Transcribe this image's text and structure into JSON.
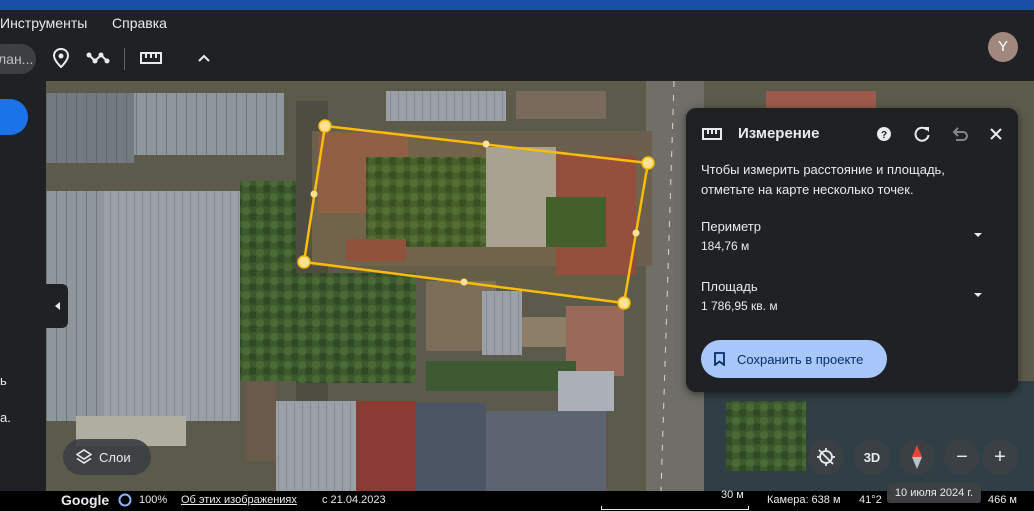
{
  "menu": {
    "items": [
      {
        "label": "Инструменты"
      },
      {
        "label": "Справка"
      }
    ]
  },
  "toolbar": {
    "search_fragment": "лан...",
    "icons": [
      "placemark-icon",
      "path-icon",
      "ruler-icon",
      "chevron-up-icon"
    ]
  },
  "user": {
    "avatar_letter": "Y",
    "avatar_color": "#a1887f"
  },
  "left_panel": {
    "fragment_1": "ь",
    "fragment_2": "а."
  },
  "measure": {
    "title": "Измерение",
    "description": "Чтобы измерить расстояние и площадь, отметьте на карте несколько точек.",
    "perimeter_label": "Периметр",
    "perimeter_value": "184,76 м",
    "area_label": "Площадь",
    "area_value": "1 786,95 кв. м",
    "save_label": "Сохранить в проекте",
    "accent_color": "#a8c7fa",
    "polygon_color": "#fbbc04"
  },
  "map_controls": {
    "layers_label": "Слои",
    "three_d_label": "3D",
    "zoom_out": "−",
    "zoom_in": "+"
  },
  "status": {
    "logo": "Google",
    "progress": "100%",
    "about_imagery": "Об этих изображениях",
    "imagery_date": "с 21.04.2023",
    "scale": "30 м",
    "camera": "Камера: 638 м",
    "coords_fragment": "41°2",
    "date_tooltip": "10 июля 2024 г.",
    "elevation": "466 м"
  }
}
